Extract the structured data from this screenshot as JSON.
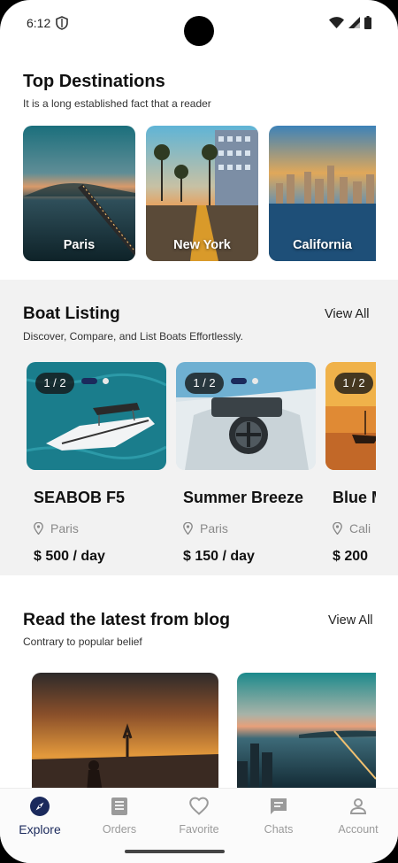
{
  "status_bar": {
    "time": "6:12"
  },
  "destinations": {
    "title": "Top Destinations",
    "subtitle": "It is a long established fact that a reader",
    "items": [
      {
        "label": "Paris"
      },
      {
        "label": "New York"
      },
      {
        "label": "California"
      }
    ]
  },
  "boats": {
    "title": "Boat Listing",
    "subtitle": "Discover, Compare, and List Boats Effortlessly.",
    "view_all": "View All",
    "items": [
      {
        "pager": "1 / 2",
        "name": "SEABOB F5",
        "location": "Paris",
        "price": "$ 500 / day"
      },
      {
        "pager": "1 / 2",
        "name": "Summer Breeze",
        "location": "Paris",
        "price": "$ 150 / day"
      },
      {
        "pager": "1 / 2",
        "name": "Blue M",
        "location": "Cali",
        "price": "$ 200"
      }
    ]
  },
  "blog": {
    "title": "Read the latest from blog",
    "subtitle": "Contrary to popular belief",
    "view_all": "View All"
  },
  "nav": {
    "items": [
      {
        "label": "Explore",
        "icon": "compass-icon",
        "active": true
      },
      {
        "label": "Orders",
        "icon": "orders-icon",
        "active": false
      },
      {
        "label": "Favorite",
        "icon": "heart-icon",
        "active": false
      },
      {
        "label": "Chats",
        "icon": "chat-icon",
        "active": false
      },
      {
        "label": "Account",
        "icon": "account-icon",
        "active": false
      }
    ]
  },
  "colors": {
    "accent": "#1b2a5c",
    "band": "#f2f2f2",
    "inactive": "#9a9a9a"
  }
}
